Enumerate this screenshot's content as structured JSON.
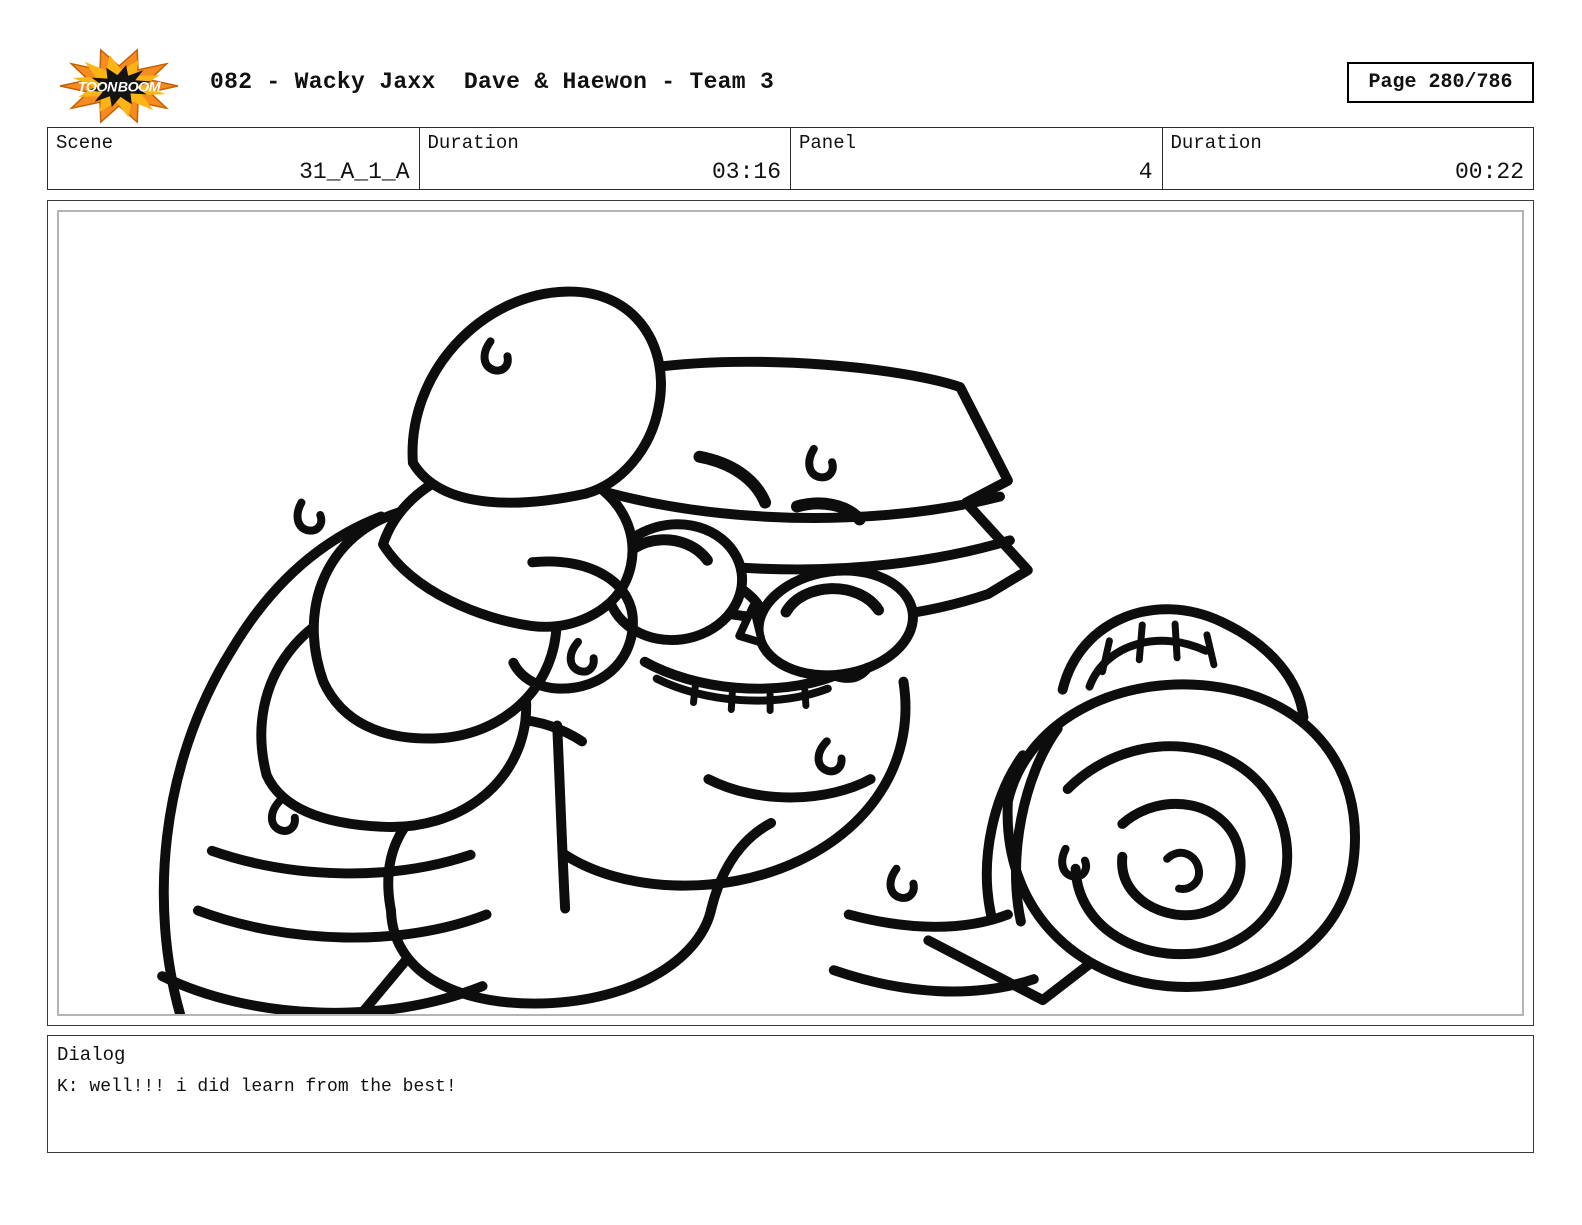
{
  "header": {
    "logo": {
      "name": "toon-boom-logo",
      "text_left": "TOON",
      "text_right": "BOOM",
      "colors": {
        "outer": "#f68b1f",
        "inner": "#fdb515",
        "core": "#141414",
        "text": "#ffffff"
      }
    },
    "title": "082 - Wacky Jaxx  Dave & Haewon - Team 3",
    "page_indicator": "Page 280/786"
  },
  "info_row": {
    "cells": [
      {
        "label": "Scene",
        "value": "31_A_1_A"
      },
      {
        "label": "Duration",
        "value": "03:16"
      },
      {
        "label": "Panel",
        "value": "4"
      },
      {
        "label": "Duration",
        "value": "00:22"
      }
    ]
  },
  "panel": {
    "ink_color": "#0d0d0d",
    "outer_border_color": "#3a3a3a",
    "inner_border_color": "#b4b4b4"
  },
  "dialog": {
    "label": "Dialog",
    "text": "K: well!!! i did learn from the best!"
  }
}
